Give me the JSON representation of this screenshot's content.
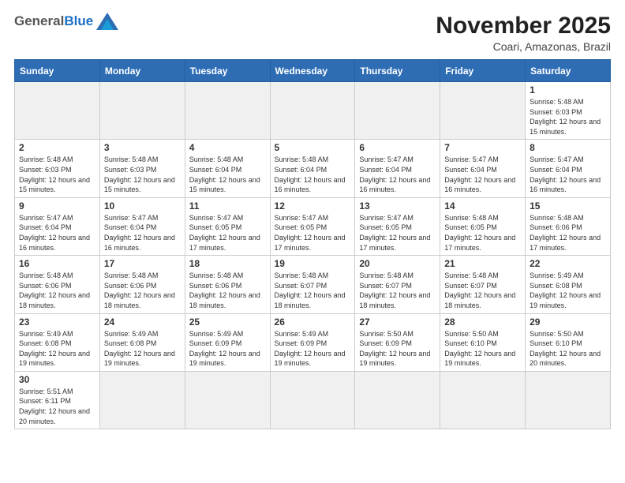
{
  "header": {
    "logo_general": "General",
    "logo_blue": "Blue",
    "month_title": "November 2025",
    "location": "Coari, Amazonas, Brazil"
  },
  "days_of_week": [
    "Sunday",
    "Monday",
    "Tuesday",
    "Wednesday",
    "Thursday",
    "Friday",
    "Saturday"
  ],
  "weeks": [
    [
      {
        "day": "",
        "info": ""
      },
      {
        "day": "",
        "info": ""
      },
      {
        "day": "",
        "info": ""
      },
      {
        "day": "",
        "info": ""
      },
      {
        "day": "",
        "info": ""
      },
      {
        "day": "",
        "info": ""
      },
      {
        "day": "1",
        "info": "Sunrise: 5:48 AM\nSunset: 6:03 PM\nDaylight: 12 hours and 15 minutes."
      }
    ],
    [
      {
        "day": "2",
        "info": "Sunrise: 5:48 AM\nSunset: 6:03 PM\nDaylight: 12 hours and 15 minutes."
      },
      {
        "day": "3",
        "info": "Sunrise: 5:48 AM\nSunset: 6:03 PM\nDaylight: 12 hours and 15 minutes."
      },
      {
        "day": "4",
        "info": "Sunrise: 5:48 AM\nSunset: 6:04 PM\nDaylight: 12 hours and 15 minutes."
      },
      {
        "day": "5",
        "info": "Sunrise: 5:48 AM\nSunset: 6:04 PM\nDaylight: 12 hours and 16 minutes."
      },
      {
        "day": "6",
        "info": "Sunrise: 5:47 AM\nSunset: 6:04 PM\nDaylight: 12 hours and 16 minutes."
      },
      {
        "day": "7",
        "info": "Sunrise: 5:47 AM\nSunset: 6:04 PM\nDaylight: 12 hours and 16 minutes."
      },
      {
        "day": "8",
        "info": "Sunrise: 5:47 AM\nSunset: 6:04 PM\nDaylight: 12 hours and 16 minutes."
      }
    ],
    [
      {
        "day": "9",
        "info": "Sunrise: 5:47 AM\nSunset: 6:04 PM\nDaylight: 12 hours and 16 minutes."
      },
      {
        "day": "10",
        "info": "Sunrise: 5:47 AM\nSunset: 6:04 PM\nDaylight: 12 hours and 16 minutes."
      },
      {
        "day": "11",
        "info": "Sunrise: 5:47 AM\nSunset: 6:05 PM\nDaylight: 12 hours and 17 minutes."
      },
      {
        "day": "12",
        "info": "Sunrise: 5:47 AM\nSunset: 6:05 PM\nDaylight: 12 hours and 17 minutes."
      },
      {
        "day": "13",
        "info": "Sunrise: 5:47 AM\nSunset: 6:05 PM\nDaylight: 12 hours and 17 minutes."
      },
      {
        "day": "14",
        "info": "Sunrise: 5:48 AM\nSunset: 6:05 PM\nDaylight: 12 hours and 17 minutes."
      },
      {
        "day": "15",
        "info": "Sunrise: 5:48 AM\nSunset: 6:06 PM\nDaylight: 12 hours and 17 minutes."
      }
    ],
    [
      {
        "day": "16",
        "info": "Sunrise: 5:48 AM\nSunset: 6:06 PM\nDaylight: 12 hours and 18 minutes."
      },
      {
        "day": "17",
        "info": "Sunrise: 5:48 AM\nSunset: 6:06 PM\nDaylight: 12 hours and 18 minutes."
      },
      {
        "day": "18",
        "info": "Sunrise: 5:48 AM\nSunset: 6:06 PM\nDaylight: 12 hours and 18 minutes."
      },
      {
        "day": "19",
        "info": "Sunrise: 5:48 AM\nSunset: 6:07 PM\nDaylight: 12 hours and 18 minutes."
      },
      {
        "day": "20",
        "info": "Sunrise: 5:48 AM\nSunset: 6:07 PM\nDaylight: 12 hours and 18 minutes."
      },
      {
        "day": "21",
        "info": "Sunrise: 5:48 AM\nSunset: 6:07 PM\nDaylight: 12 hours and 18 minutes."
      },
      {
        "day": "22",
        "info": "Sunrise: 5:49 AM\nSunset: 6:08 PM\nDaylight: 12 hours and 19 minutes."
      }
    ],
    [
      {
        "day": "23",
        "info": "Sunrise: 5:49 AM\nSunset: 6:08 PM\nDaylight: 12 hours and 19 minutes."
      },
      {
        "day": "24",
        "info": "Sunrise: 5:49 AM\nSunset: 6:08 PM\nDaylight: 12 hours and 19 minutes."
      },
      {
        "day": "25",
        "info": "Sunrise: 5:49 AM\nSunset: 6:09 PM\nDaylight: 12 hours and 19 minutes."
      },
      {
        "day": "26",
        "info": "Sunrise: 5:49 AM\nSunset: 6:09 PM\nDaylight: 12 hours and 19 minutes."
      },
      {
        "day": "27",
        "info": "Sunrise: 5:50 AM\nSunset: 6:09 PM\nDaylight: 12 hours and 19 minutes."
      },
      {
        "day": "28",
        "info": "Sunrise: 5:50 AM\nSunset: 6:10 PM\nDaylight: 12 hours and 19 minutes."
      },
      {
        "day": "29",
        "info": "Sunrise: 5:50 AM\nSunset: 6:10 PM\nDaylight: 12 hours and 20 minutes."
      }
    ],
    [
      {
        "day": "30",
        "info": "Sunrise: 5:51 AM\nSunset: 6:11 PM\nDaylight: 12 hours and 20 minutes."
      },
      {
        "day": "",
        "info": ""
      },
      {
        "day": "",
        "info": ""
      },
      {
        "day": "",
        "info": ""
      },
      {
        "day": "",
        "info": ""
      },
      {
        "day": "",
        "info": ""
      },
      {
        "day": "",
        "info": ""
      }
    ]
  ]
}
